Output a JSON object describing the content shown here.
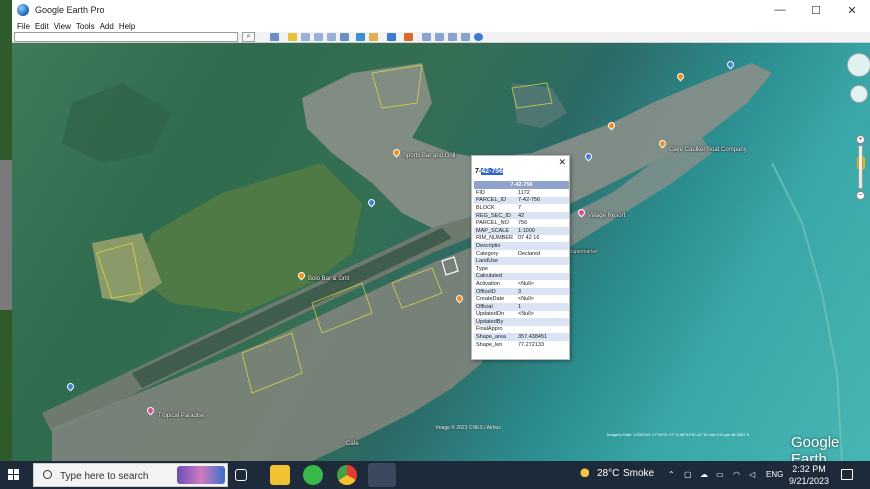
{
  "window": {
    "title": "Google Earth Pro",
    "controls": [
      "—",
      "☐",
      "✕"
    ]
  },
  "menu": [
    "File",
    "Edit",
    "View",
    "Tools",
    "Add",
    "Help"
  ],
  "search": {
    "value": "",
    "placeholder": ""
  },
  "map": {
    "places": [
      {
        "name": "Sports Bar and Grill",
        "color": "orange"
      },
      {
        "name": "Bolo Bar & Grill",
        "color": "orange"
      },
      {
        "name": "Caye Caulker Boat Company",
        "color": "orange"
      },
      {
        "name": "Village Resort",
        "color": "pink"
      },
      {
        "name": "Supermarket",
        "color": "blue"
      },
      {
        "name": "Cafe",
        "color": "orange"
      },
      {
        "name": "Tropical Paradise",
        "color": "pink"
      }
    ],
    "copyright": "Image © 2023 CNES / Airbus",
    "status": "Imagery Date: 1/23/2021    17°44'51.37\" N  88°01'30.42\" W  elev  0 ft   eye alt  3281 ft",
    "brand": "Google Earth"
  },
  "popup": {
    "heading_prefix": "7-",
    "heading_selected": "42-756",
    "close": "✕",
    "table_title": "7-42-756",
    "rows": [
      {
        "k": "FID",
        "v": "1172"
      },
      {
        "k": "PARCEL_ID",
        "v": "7-42-756"
      },
      {
        "k": "BLOCK",
        "v": "7"
      },
      {
        "k": "REG_SEC_ID",
        "v": "42"
      },
      {
        "k": "PARCEL_NO",
        "v": "756"
      },
      {
        "k": "MAP_SCALE",
        "v": "1:1000"
      },
      {
        "k": "RIM_NUMBER",
        "v": "07 42 16"
      },
      {
        "k": "Descriptio",
        "v": ""
      },
      {
        "k": "Category",
        "v": "Declared"
      },
      {
        "k": "LandUse",
        "v": ""
      },
      {
        "k": "Type",
        "v": ""
      },
      {
        "k": "Calculated",
        "v": ""
      },
      {
        "k": "Activation",
        "v": "<Null>"
      },
      {
        "k": "OfficeID",
        "v": "3"
      },
      {
        "k": "CreateDate",
        "v": "<Null>"
      },
      {
        "k": "Official",
        "v": "1"
      },
      {
        "k": "UpdatedOn",
        "v": "<Null>"
      },
      {
        "k": "UpdatedBy",
        "v": ""
      },
      {
        "k": "FinalAppro",
        "v": ""
      },
      {
        "k": "Shape_area",
        "v": "357.438451"
      },
      {
        "k": "Shape_len",
        "v": "77.272133"
      }
    ]
  },
  "taskbar": {
    "search_placeholder": "Type here to search",
    "weather_temp": "28°C",
    "weather_desc": "Smoke",
    "lang": "ENG",
    "time": "2:32 PM",
    "date": "9/21/2023"
  }
}
